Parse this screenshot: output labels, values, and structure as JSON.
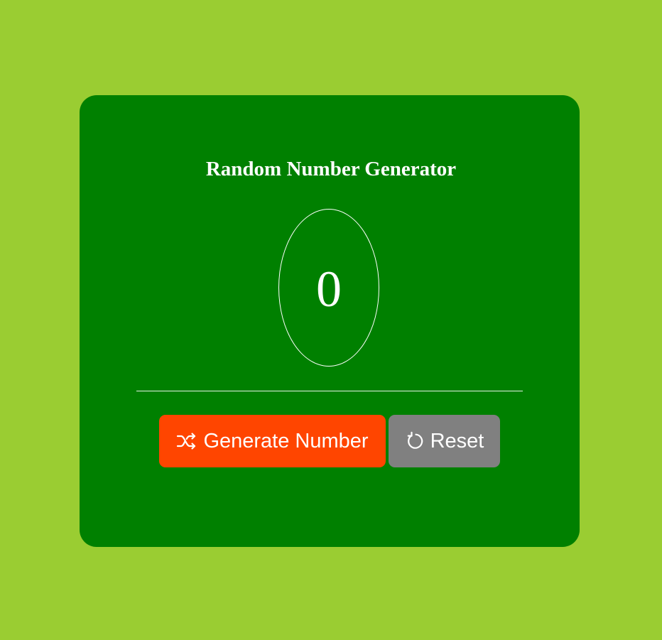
{
  "app": {
    "title": "Random Number Generator"
  },
  "display": {
    "value": "0"
  },
  "actions": {
    "generate_label": "Generate Number",
    "generate_icon": "shuffle-icon",
    "reset_label": "Reset",
    "reset_icon": "refresh-icon"
  },
  "colors": {
    "page_background": "#9acd32",
    "card_background": "#008000",
    "generate_button": "#ff4500",
    "reset_button": "#808080",
    "text": "#ffffff"
  }
}
